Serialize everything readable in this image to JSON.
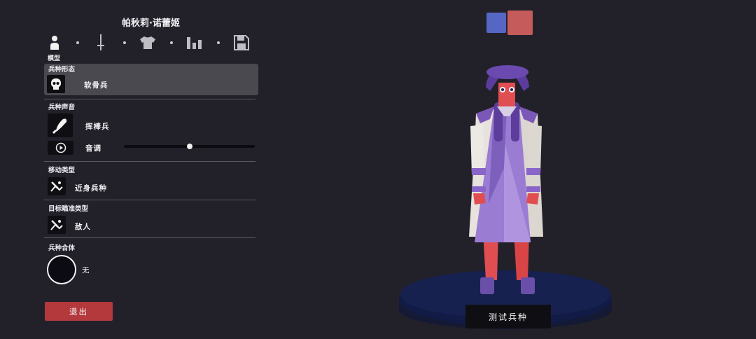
{
  "unit_name": "帕秋莉·诺蕾姬",
  "tabs": [
    {
      "icon": "person-icon",
      "label": "模型",
      "active": true
    },
    {
      "icon": "sword-icon",
      "active": false
    },
    {
      "icon": "shirt-icon",
      "active": false
    },
    {
      "icon": "stats-icon",
      "active": false
    },
    {
      "icon": "save-icon",
      "active": false
    }
  ],
  "sections": {
    "unit_base": {
      "title": "兵种形态",
      "value": "软骨兵",
      "icon": "skull-icon"
    },
    "unit_voice": {
      "title": "兵种声音",
      "value": "挥棒兵",
      "icon": "club-icon",
      "pitch_label": "音调",
      "pitch_value": 0.5
    },
    "movement": {
      "title": "移动类型",
      "value": "近身兵种",
      "icon": "melee-run-icon"
    },
    "targeting": {
      "title": "目标瞄准类型",
      "value": "敌人",
      "icon": "target-enemy-icon"
    },
    "combine": {
      "title": "兵种合体",
      "value": "无"
    }
  },
  "exit_label": "退出",
  "test_label": "测试兵种",
  "team_colors": {
    "blue": "#5566c4",
    "red": "#c55b5b",
    "selected": "red"
  }
}
